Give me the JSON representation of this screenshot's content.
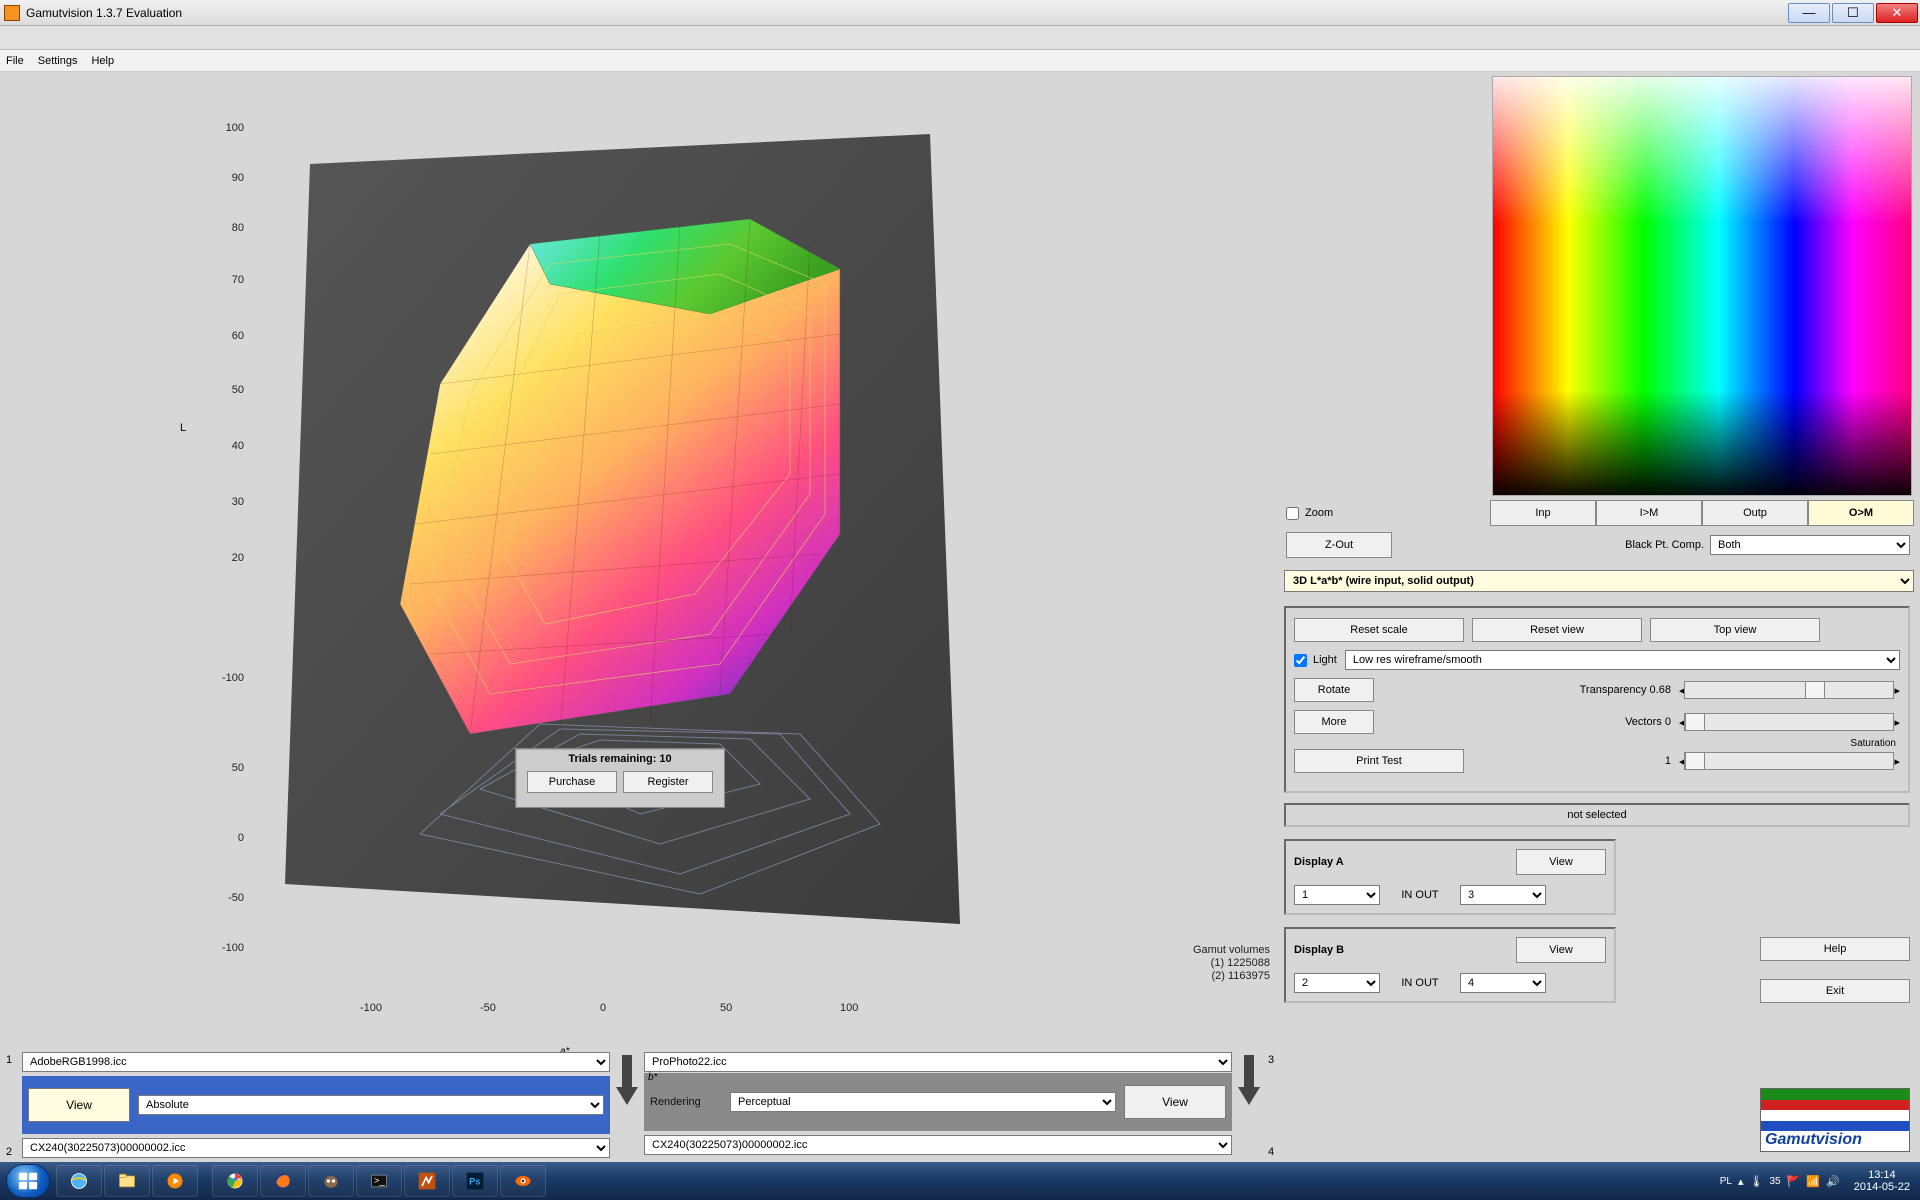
{
  "window": {
    "title": "Gamutvision 1.3.7  Evaluation",
    "minimize": "—",
    "maximize": "☐",
    "close": "✕"
  },
  "menu": {
    "file": "File",
    "settings": "Settings",
    "help": "Help"
  },
  "plot": {
    "axisLticks": [
      "100",
      "90",
      "80",
      "70",
      "60",
      "50",
      "40",
      "30",
      "20",
      "-100",
      "50",
      "0",
      "-50",
      "-100"
    ],
    "axisBtop": [
      "-100",
      "-50",
      "0",
      "50",
      "100"
    ],
    "axisLlbl": "L",
    "lblA": "a*",
    "lblB": "b*",
    "gvol1": "Gamut volumes",
    "gvol2": "(1) 1225088",
    "gvol3": "(2) 1163975"
  },
  "trial": {
    "title": "Trials remaining: 10",
    "purchase": "Purchase",
    "register": "Register"
  },
  "profiles": {
    "num1": "1",
    "num2": "2",
    "num3": "3",
    "num4": "4",
    "prof1": "AdobeRGB1998.icc",
    "prof2": "CX240(30225073)00000002.icc",
    "prof3": "ProPhoto22.icc",
    "prof4": "CX240(30225073)00000002.icc",
    "view": "View",
    "renderingLbl": "Rendering",
    "absolute": "Absolute",
    "perceptual": "Perceptual"
  },
  "right": {
    "zoom": "Zoom",
    "inp": "Inp",
    "im": "I>M",
    "outp": "Outp",
    "om": "O>M",
    "zout": "Z-Out",
    "bplbl": "Black Pt. Comp.",
    "bpval": "Both",
    "modesel": "3D L*a*b* (wire input, solid output)",
    "resetscale": "Reset scale",
    "resetview": "Reset view",
    "topview": "Top view",
    "light": "Light",
    "wireframe": "Low res wireframe/smooth",
    "rotate": "Rotate",
    "transp": "Transparency 0.68",
    "more": "More",
    "vectors": "Vectors 0",
    "saturation": "Saturation",
    "satval": "1",
    "printtest": "Print Test",
    "nosel": "not selected",
    "dispA": "Display A",
    "dispB": "Display B",
    "inout": "IN  OUT",
    "selA1": "1",
    "selA2": "3",
    "selB1": "2",
    "selB2": "4",
    "viewbtn": "View",
    "help": "Help",
    "exit": "Exit",
    "logo": "Gamutvision"
  },
  "taskbar": {
    "lang": "PL",
    "temp": "35",
    "time": "13:14",
    "date": "2014-05-22"
  }
}
